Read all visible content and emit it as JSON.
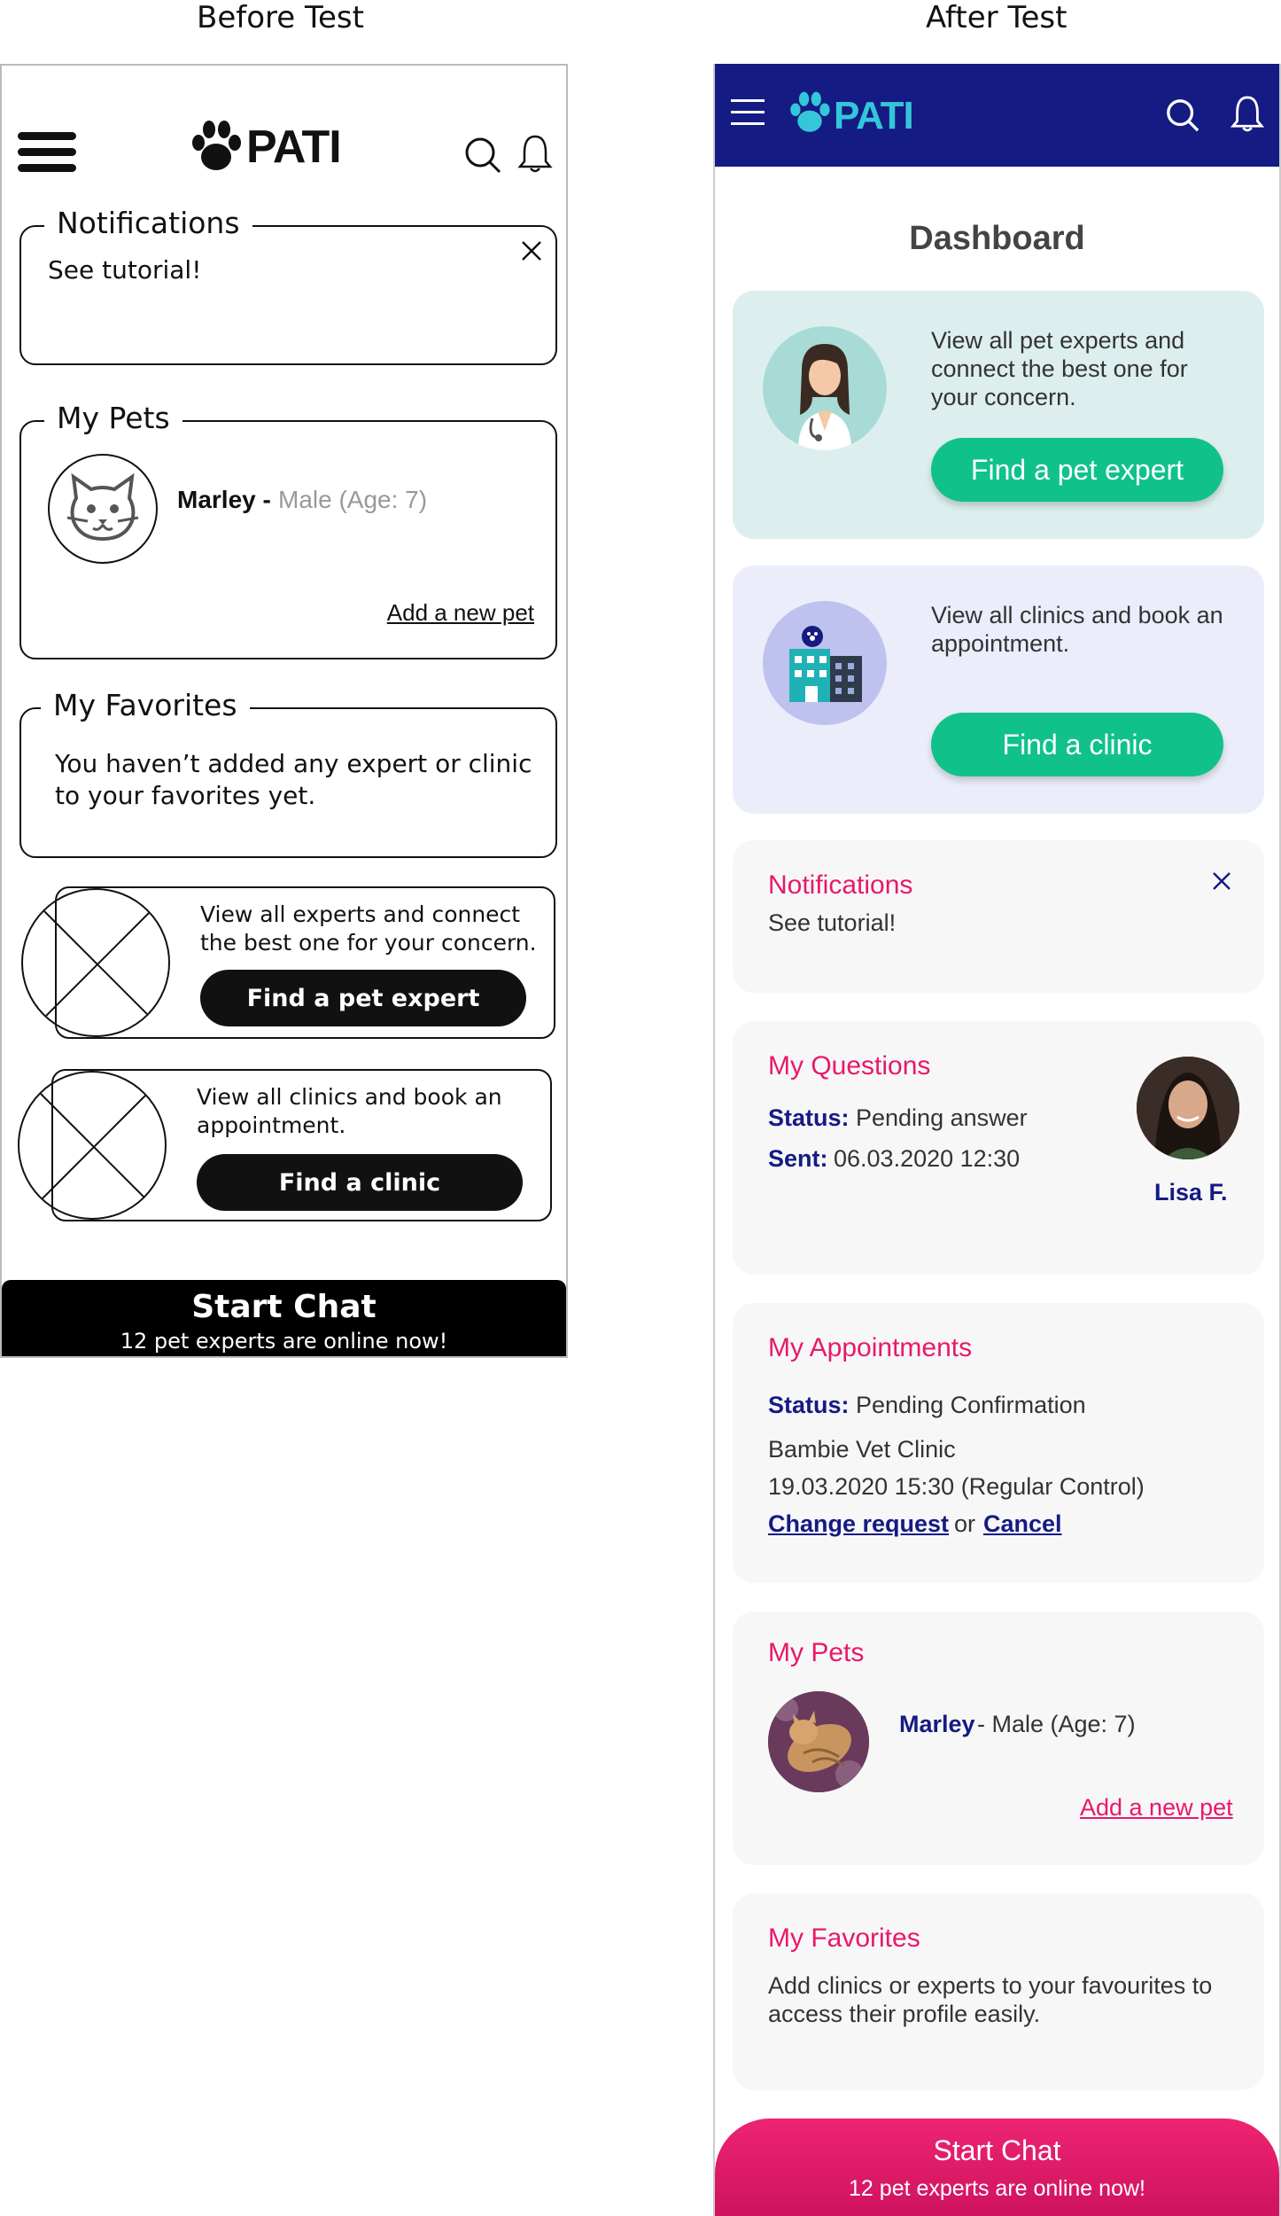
{
  "titles": {
    "before": "Before Test",
    "after": "After Test"
  },
  "before": {
    "brand": "PATI",
    "notifications": {
      "title": "Notifications",
      "text": "See tutorial!"
    },
    "pets": {
      "title": "My Pets",
      "pet_name": "Marley -",
      "pet_detail": "Male (Age: 7)",
      "add_link": "Add a new pet"
    },
    "favorites": {
      "title": "My Favorites",
      "text": "You haven’t added any expert or clinic to your favorites yet."
    },
    "expert_card": {
      "text": "View all experts and connect the best one for your concern.",
      "button": "Find a pet expert"
    },
    "clinic_card": {
      "text": "View all clinics and  book an appointment.",
      "button": "Find a clinic"
    },
    "chat": {
      "title": "Start Chat",
      "subtitle": "12 pet experts are online now!"
    }
  },
  "after": {
    "brand": "PATI",
    "page_title": "Dashboard",
    "expert_card": {
      "text": "View all pet experts and connect the best one for your concern.",
      "button": "Find a pet expert"
    },
    "clinic_card": {
      "text": "View all clinics and  book an appointment.",
      "button": "Find a clinic"
    },
    "notifications": {
      "title": "Notifications",
      "text": "See tutorial!"
    },
    "questions": {
      "title": "My Questions",
      "status_label": "Status:",
      "status_value": "Pending answer",
      "sent_label": "Sent:",
      "sent_value": "06.03.2020 12:30",
      "expert_name": "Lisa F."
    },
    "appointments": {
      "title": "My Appointments",
      "status_label": "Status:",
      "status_value": "Pending Confirmation",
      "clinic": "Bambie Vet Clinic",
      "datetime": "19.03.2020 15:30 (Regular Control)",
      "change_link": "Change request",
      "or": "or",
      "cancel_link": "Cancel"
    },
    "pets": {
      "title": "My Pets",
      "pet_name": "Marley",
      "pet_detail": "- Male (Age: 7)",
      "add_link": "Add a new pet"
    },
    "favorites": {
      "title": "My Favorites",
      "text": "Add clinics or experts to your favourites to access their profile easily."
    },
    "chat": {
      "title": "Start Chat",
      "subtitle": "12 pet experts are online now!"
    }
  },
  "colors": {
    "navy": "#141b82",
    "pink": "#e8186b",
    "green": "#10c28a",
    "teal": "#34c6d9",
    "expert_bg": "#dcefee",
    "clinic_bg": "#ecedfb"
  }
}
